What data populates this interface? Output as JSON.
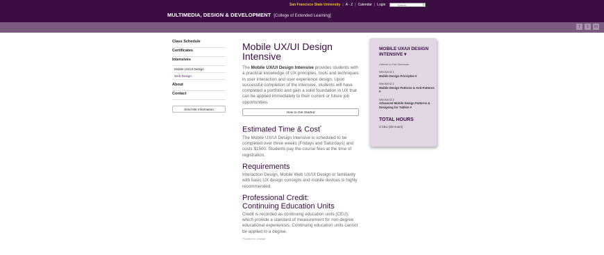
{
  "utility_nav": {
    "university": "San Francisco State University",
    "links": [
      "A - Z",
      "Calendar",
      "Login"
    ],
    "search_placeholder": "Search"
  },
  "brand": {
    "title": "MULTIMEDIA, DESIGN & DEVELOPMENT",
    "subtitle": "[College of Extended Learning]"
  },
  "social_icons": [
    "facebook-icon",
    "twitter-icon",
    "linkedin-icon"
  ],
  "sidebar": {
    "items": [
      {
        "label": "Class Schedule"
      },
      {
        "label": "Certificates"
      },
      {
        "label": "Intensives"
      }
    ],
    "subitems": [
      {
        "label": "Mobile UX/UI Design"
      },
      {
        "label": "Web Design"
      }
    ],
    "items_after": [
      {
        "label": "About"
      },
      {
        "label": "Contact"
      }
    ],
    "button_label": "Send Me Information"
  },
  "main": {
    "title": "Mobile UX/UI Design Intensive",
    "intro_prefix": "The ",
    "intro_bold": "Mobile UX/UI Design Intensive",
    "intro_rest": " provides students with a practical knowledge of UX principles, tools and techniques in user interaction and user experience design. Upon successful completion of the intensive, students will have completed a portfolio and gain a solid foundation in UX that can be applied immediately to their current or future job opportunities.",
    "get_started": "How to Get Started",
    "time_heading": "Estimated Time & Cost",
    "time_mark": "*",
    "time_text": "The Mobile UX/UI Design Intensive is scheduled to be completed over three weeks (Fridays and Saturdays) and costs $1500. Students pay the course fees at the time of registration.",
    "req_heading": "Requirements",
    "req_text": "Interaction Design, Mobile Web UX/UI Design or familiarity with basic UX design concepts and mobile devices is highly recommended.",
    "credit_heading_1": "Professional Credit:",
    "credit_heading_2": "Continuing Education Units",
    "credit_text": "Credit is recorded as continuing education units (CEU), which provide a standard of measurement for non-degree educational experiences. Continuing education units cannot be applied to a degree.",
    "note": "*Subject to change"
  },
  "card": {
    "title": "MOBILE UX/UI DESIGN INTENSIVE ▾",
    "offered": "Offered in Fall Semester",
    "weekends": [
      {
        "label": "Weekend 1",
        "topic": "Mobile Design Principles ▾"
      },
      {
        "label": "Weekend 2",
        "topic": "Mobile Design Patterns & Anti-Patterns ▾"
      },
      {
        "label": "Weekend 3",
        "topic": "Advanced Mobile Design Patterns & Designing for Tablets ▾"
      }
    ],
    "total_heading": "TOTAL HOURS",
    "total_value": "3 CEU (30 Hours)"
  }
}
